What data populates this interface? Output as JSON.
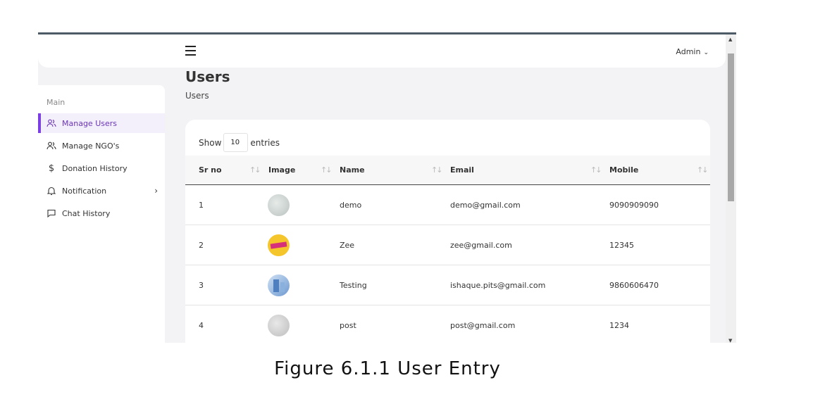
{
  "topbar": {
    "admin_label": "Admin"
  },
  "page": {
    "title": "Users",
    "breadcrumb": "Users"
  },
  "sidebar": {
    "section": "Main",
    "items": [
      {
        "label": "Manage Users",
        "icon": "users-icon"
      },
      {
        "label": "Manage NGO's",
        "icon": "users-icon"
      },
      {
        "label": "Donation History",
        "icon": "dollar-icon"
      },
      {
        "label": "Notification",
        "icon": "bell-icon"
      },
      {
        "label": "Chat History",
        "icon": "chat-icon"
      }
    ]
  },
  "table": {
    "show_label": "Show",
    "entries_value": "10",
    "entries_label": "entries",
    "columns": [
      "Sr no",
      "Image",
      "Name",
      "Email",
      "Mobile"
    ],
    "rows": [
      {
        "sr": "1",
        "name": "demo",
        "email": "demo@gmail.com",
        "mobile": "9090909090"
      },
      {
        "sr": "2",
        "name": "Zee",
        "email": "zee@gmail.com",
        "mobile": "12345"
      },
      {
        "sr": "3",
        "name": "Testing",
        "email": "ishaque.pits@gmail.com",
        "mobile": "9860606470"
      },
      {
        "sr": "4",
        "name": "post",
        "email": "post@gmail.com",
        "mobile": "1234"
      }
    ]
  },
  "caption": "Figure 6.1.1 User Entry",
  "colors": {
    "accent": "#7b3fe4",
    "active_bg": "#f4f0fb"
  }
}
